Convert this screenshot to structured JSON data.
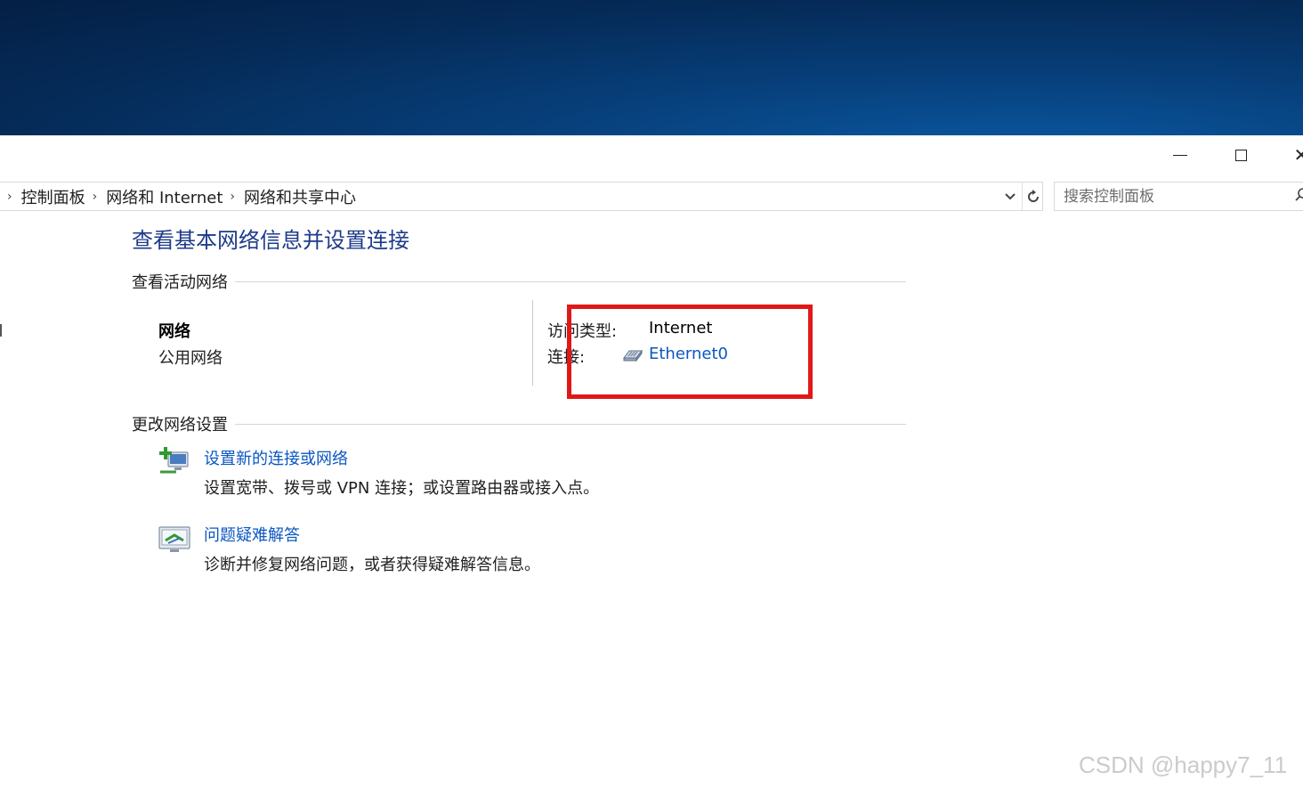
{
  "window": {
    "minimize_glyph": "—",
    "close_glyph": "✕"
  },
  "address": {
    "crumbs": [
      "控制面板",
      "网络和 Internet",
      "网络和共享中心"
    ],
    "search_placeholder": "搜索控制面板"
  },
  "main": {
    "title": "查看基本网络信息并设置连接",
    "active_section": "查看活动网络",
    "network": {
      "name": "网络",
      "type": "公用网络",
      "access_label": "访问类型:",
      "access_value": "Internet",
      "connection_label": "连接:",
      "connection_value": "Ethernet0"
    },
    "change_section": "更改网络设置",
    "tasks": [
      {
        "title": "设置新的连接或网络",
        "desc": "设置宽带、拨号或 VPN 连接；或设置路由器或接入点。"
      },
      {
        "title": "问题疑难解答",
        "desc": "诊断并修复网络问题，或者获得疑难解答信息。"
      }
    ]
  },
  "watermark": "CSDN @happy7_11",
  "colors": {
    "link": "#0b57c2",
    "title": "#1e3b8a",
    "highlight": "#e01818"
  }
}
